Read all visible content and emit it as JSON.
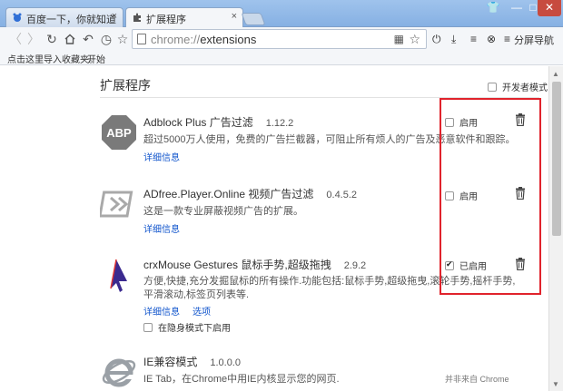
{
  "tabs": [
    {
      "label": "百度一下，你就知道",
      "close": "×",
      "active": false
    },
    {
      "label": "扩展程序",
      "close": "×",
      "active": true
    }
  ],
  "window_controls": {
    "minimize": "—",
    "maximize": "□",
    "close": "✕"
  },
  "toolbar": {
    "back": "〈",
    "forward": "〉",
    "reload": "↻",
    "undo": "↶",
    "history": "◷",
    "home": "☆",
    "url_scheme": "chrome://",
    "url_path": "extensions",
    "power": "⏻",
    "download": "⤓",
    "settings": "≡",
    "profile": "⊗",
    "menu": "≡",
    "split_nav": "分屏导航"
  },
  "bookmarks": {
    "import": "点击这里导入收藏夹。",
    "start": "开始"
  },
  "page": {
    "title": "扩展程序",
    "dev_mode": "开发者模式"
  },
  "extensions": [
    {
      "name": "Adblock Plus 广告过滤",
      "version": "1.12.2",
      "desc": [
        "超过5000万人使用，免费的广告拦截器，可阻止所有烦人的广告及恶意软件和跟踪。"
      ],
      "details": "详细信息",
      "options": "",
      "enable_label": "启用",
      "enabled": false,
      "incognito": ""
    },
    {
      "name": "ADfree.Player.Online 视频广告过滤",
      "version": "0.4.5.2",
      "desc": [
        "这是一款专业屏蔽视频广告的扩展。"
      ],
      "details": "详细信息",
      "options": "",
      "enable_label": "启用",
      "enabled": false,
      "incognito": ""
    },
    {
      "name": "crxMouse Gestures 鼠标手势,超级拖拽",
      "version": "2.9.2",
      "desc": [
        "方便,快捷,充分发掘鼠标的所有操作.功能包括:鼠标手势,超级拖曳,滚轮手势,摇杆手势,",
        "平滑滚动,标签页列表等."
      ],
      "details": "详细信息",
      "options": "选项",
      "enable_label": "已启用",
      "enabled": true,
      "incognito": "在隐身模式下启用"
    },
    {
      "name": "IE兼容模式",
      "version": "1.0.0.0",
      "desc": [
        "IE Tab，在Chrome中用IE内核显示您的网页."
      ],
      "details": "",
      "options": "",
      "enable_label": "",
      "enabled": false,
      "incognito": "",
      "note": "并非来自 Chrome"
    }
  ],
  "colors": {
    "highlight": "#e0232c",
    "link": "#1155cc"
  }
}
